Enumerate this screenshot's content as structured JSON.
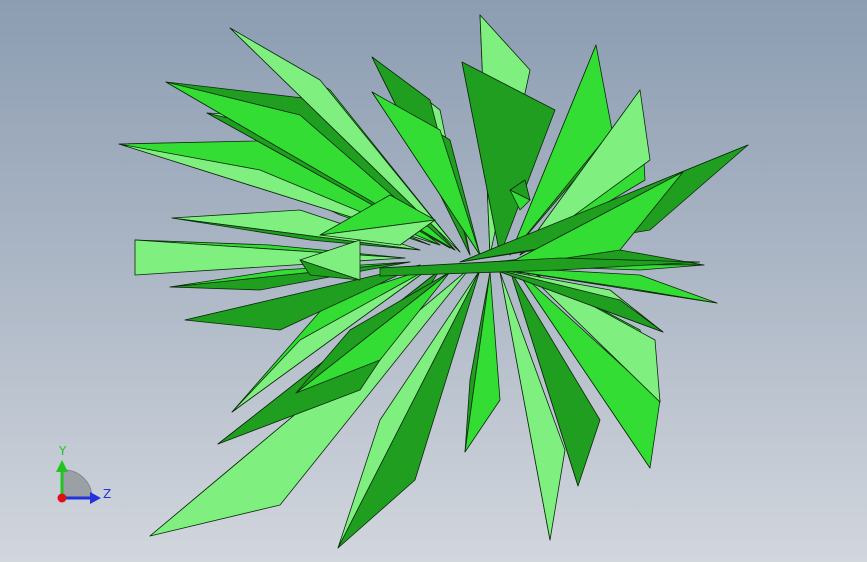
{
  "viewport": {
    "background_top": "#8c9db2",
    "background_bottom": "#d2d6dd"
  },
  "model": {
    "leaf_color": "#33dd33",
    "leaf_light": "#7ff07f",
    "leaf_dark": "#1f9e1f",
    "edge_color": "#0b2a0b"
  },
  "triad": {
    "y_label": "Y",
    "z_label": "Z",
    "y_color": "#22c422",
    "z_color": "#2233dd",
    "x_color": "#dd1111"
  }
}
